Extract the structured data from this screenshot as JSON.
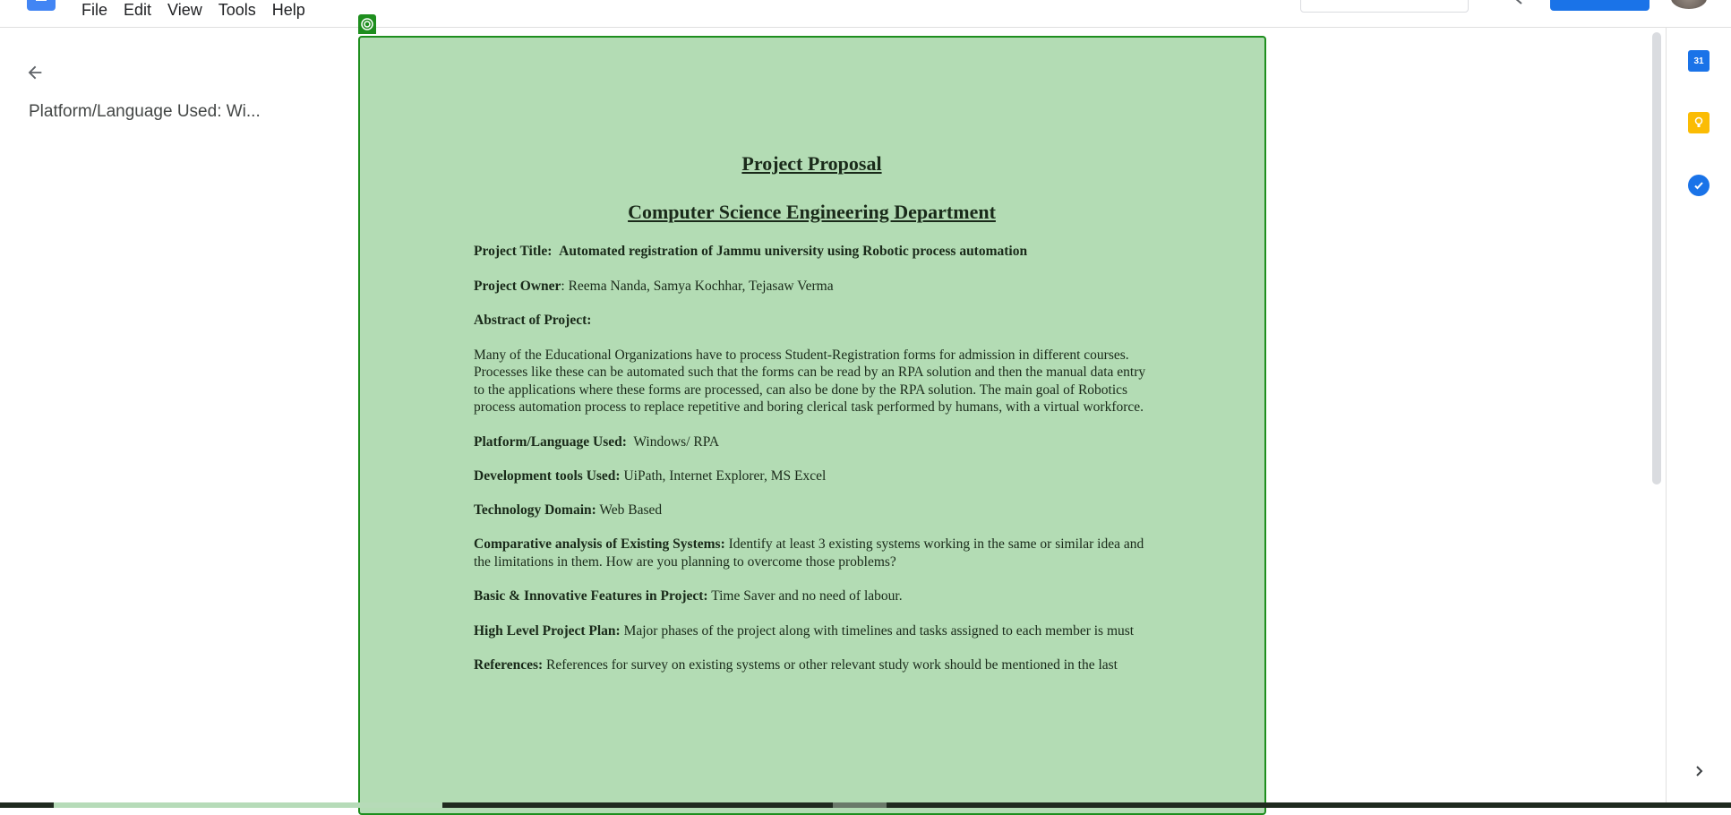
{
  "menu": {
    "items": [
      "File",
      "Edit",
      "View",
      "Tools",
      "Help"
    ]
  },
  "outline": {
    "back_icon": "arrow-left-icon",
    "item": "Platform/Language Used:  Wi..."
  },
  "document": {
    "title": "Project Proposal",
    "department": "Computer Science Engineering Department",
    "project_title_label": "Project Title:",
    "project_title_value": "Automated registration of Jammu university using Robotic process automation",
    "owner_label": "Project Owner",
    "owner_value": ": Reema Nanda, Samya Kochhar, Tejasaw Verma",
    "abstract_label": "Abstract of Project:",
    "abstract_text": "Many of the Educational Organizations have to process Student-Registration forms for admission in different courses. Processes like these can be automated such that the forms can be read by an RPA solution and then the manual data entry to the applications where these forms are processed, can also be done by the RPA solution. The main goal of Robotics process automation process to replace repetitive and boring clerical task performed by humans, with a virtual workforce.",
    "platform_label": "Platform/Language Used:",
    "platform_value": "Windows/ RPA",
    "tools_label": "Development tools Used:",
    "tools_value": "UiPath, Internet Explorer, MS Excel",
    "domain_label": "Technology Domain:",
    "domain_value": "Web Based",
    "comparative_label": "Comparative analysis of Existing Systems:",
    "comparative_value": "Identify at least 3 existing systems working in the same or similar idea and the limitations in them. How are you planning to overcome those problems?",
    "features_label": "Basic & Innovative Features in Project:",
    "features_value": "Time Saver and no need of labour.",
    "plan_label": "High Level Project Plan:",
    "plan_value": "Major phases of the project along with timelines and tasks assigned to each member is must",
    "references_label": "References:",
    "references_value": "References for survey on existing systems or other relevant study work should be mentioned in the last"
  },
  "side_panel": {
    "calendar_label": "31",
    "icons": [
      "calendar-icon",
      "keep-icon",
      "tasks-icon",
      "chevron-right-icon"
    ]
  },
  "colors": {
    "highlight_fill": "#b3dcb4",
    "highlight_border": "#1e8e1e",
    "accent": "#1a73e8"
  }
}
